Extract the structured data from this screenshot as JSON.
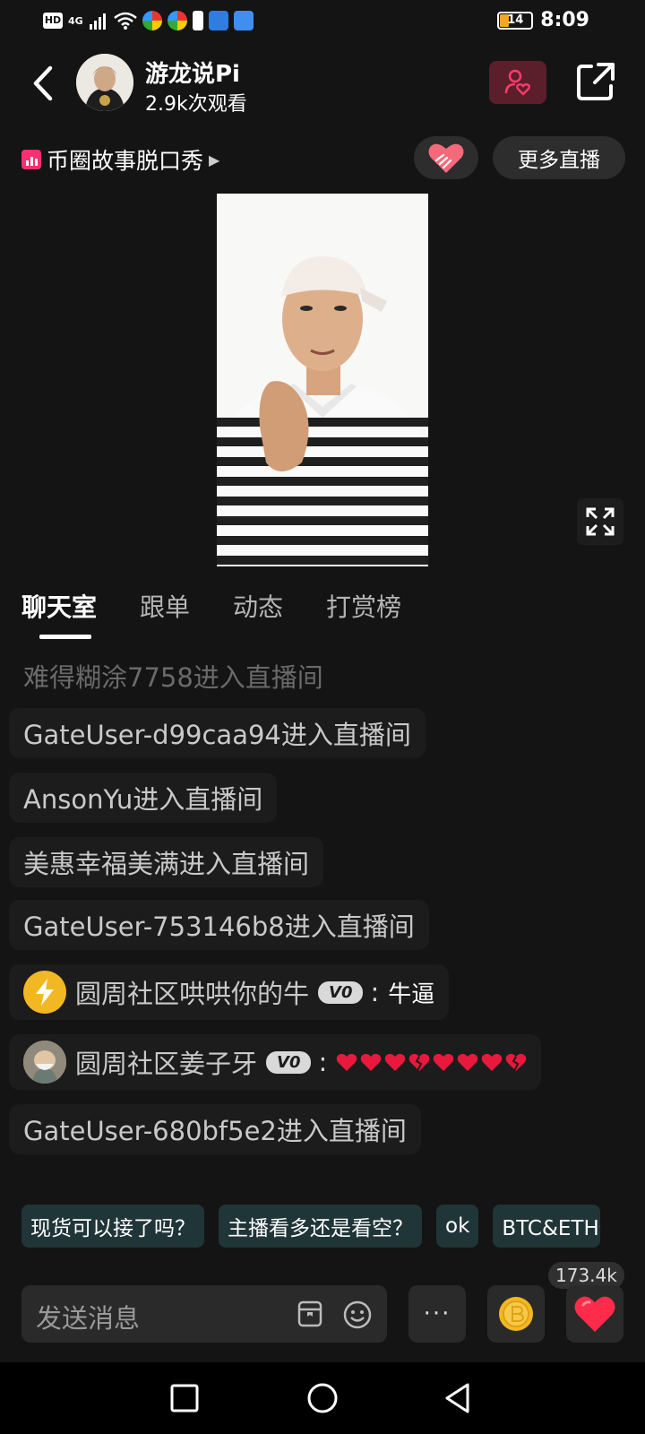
{
  "status_bar": {
    "network": "4G",
    "hd_label": "HD",
    "battery": "14",
    "time": "8:09"
  },
  "header": {
    "streamer_name": "游龙说Pi",
    "view_count": "2.9k次观看"
  },
  "subheader": {
    "category": "币圈故事脱口秀",
    "more_live_label": "更多直播"
  },
  "tabs": [
    {
      "label": "聊天室",
      "active": true
    },
    {
      "label": "跟单",
      "active": false
    },
    {
      "label": "动态",
      "active": false
    },
    {
      "label": "打赏榜",
      "active": false
    }
  ],
  "chat": {
    "messages": [
      {
        "text": "难得糊涂7758进入直播间"
      },
      {
        "text": "GateUser-d99caa94进入直播间"
      },
      {
        "text": "AnsonYu进入直播间"
      },
      {
        "text": "美惠幸福美满进入直播间"
      },
      {
        "text": "GateUser-753146b8进入直播间"
      },
      {
        "user": "圆周社区哄哄你的牛",
        "badge": "V0",
        "colon": ":",
        "content": "牛逼"
      },
      {
        "user": "圆周社区姜子牙",
        "badge": "V0",
        "colon": ":",
        "hearts": [
          "heart",
          "heart",
          "heart",
          "broken-heart",
          "heart",
          "heart",
          "heart",
          "broken-heart"
        ]
      },
      {
        "text": "GateUser-680bf5e2进入直播间"
      }
    ]
  },
  "quick_replies": [
    "现货可以接了吗？",
    "主播看多还是看空？",
    "ok",
    "BTC&ETH价"
  ],
  "bottom": {
    "input_placeholder": "发送消息",
    "more_label": "···",
    "like_count": "173.4k"
  },
  "colors": {
    "background": "#141414",
    "accent_pink": "#ff2d73",
    "heart_red": "#ff2b4a",
    "chip_bg": "#203538",
    "coin_gold": "#f2b824"
  }
}
